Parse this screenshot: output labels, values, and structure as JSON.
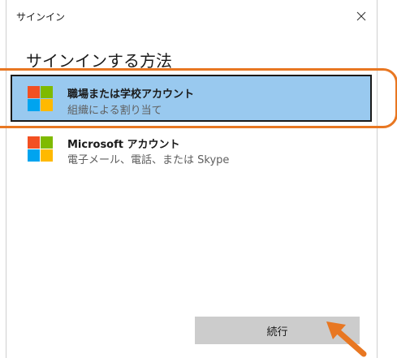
{
  "window": {
    "title": "サインイン"
  },
  "heading": "サインインする方法",
  "options": [
    {
      "title": "職場または学校アカウント",
      "subtitle": "組織による割り当て",
      "selected": true,
      "icon": "microsoft-logo-icon"
    },
    {
      "title": "Microsoft アカウント",
      "subtitle": "電子メール、電話、または Skype",
      "selected": false,
      "icon": "microsoft-logo-icon"
    }
  ],
  "continue_label": "続行",
  "colors": {
    "selected_bg": "#99c9ef",
    "highlight_annotation": "#e87722",
    "button_bg": "#cccccc",
    "logo_red": "#f25022",
    "logo_green": "#7fba00",
    "logo_blue": "#00a4ef",
    "logo_yellow": "#ffb900"
  }
}
